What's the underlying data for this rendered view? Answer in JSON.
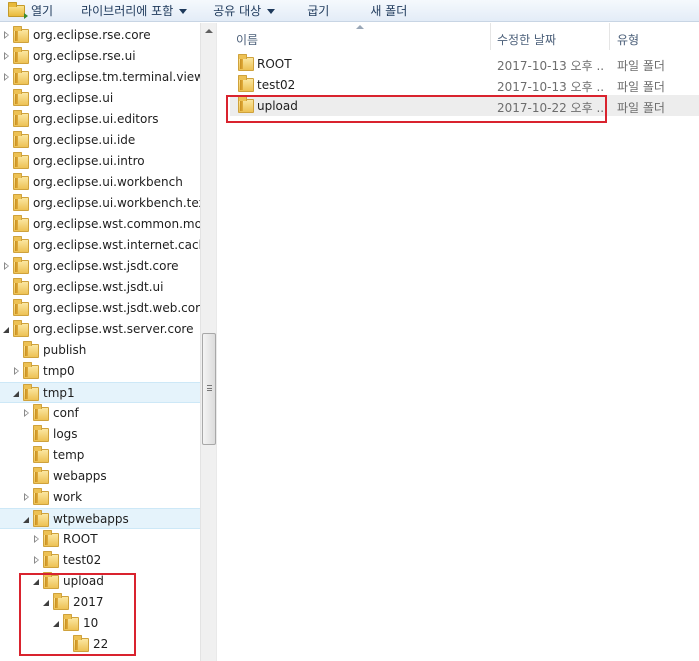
{
  "toolbar": {
    "open_label": "열기",
    "library_label": "라이브러리에 포함",
    "share_label": "공유 대상",
    "burn_label": "굽기",
    "newfolder_label": "새 폴더"
  },
  "nav_tree": [
    {
      "label": "org.eclipse.rse.core",
      "expander": "collapsed",
      "depth": 0
    },
    {
      "label": "org.eclipse.rse.ui",
      "expander": "collapsed",
      "depth": 0
    },
    {
      "label": "org.eclipse.tm.terminal.view.ui",
      "expander": "collapsed",
      "depth": 0
    },
    {
      "label": "org.eclipse.ui",
      "expander": "none",
      "depth": 0
    },
    {
      "label": "org.eclipse.ui.editors",
      "expander": "none",
      "depth": 0
    },
    {
      "label": "org.eclipse.ui.ide",
      "expander": "none",
      "depth": 0
    },
    {
      "label": "org.eclipse.ui.intro",
      "expander": "none",
      "depth": 0
    },
    {
      "label": "org.eclipse.ui.workbench",
      "expander": "none",
      "depth": 0
    },
    {
      "label": "org.eclipse.ui.workbench.texted",
      "expander": "none",
      "depth": 0
    },
    {
      "label": "org.eclipse.wst.common.modu",
      "expander": "none",
      "depth": 0
    },
    {
      "label": "org.eclipse.wst.internet.cache",
      "expander": "none",
      "depth": 0
    },
    {
      "label": "org.eclipse.wst.jsdt.core",
      "expander": "collapsed",
      "depth": 0
    },
    {
      "label": "org.eclipse.wst.jsdt.ui",
      "expander": "none",
      "depth": 0
    },
    {
      "label": "org.eclipse.wst.jsdt.web.core",
      "expander": "none",
      "depth": 0
    },
    {
      "label": "org.eclipse.wst.server.core",
      "expander": "expanded",
      "depth": 0
    },
    {
      "label": "publish",
      "expander": "none",
      "depth": 1
    },
    {
      "label": "tmp0",
      "expander": "collapsed",
      "depth": 1
    },
    {
      "label": "tmp1",
      "expander": "expanded",
      "depth": 1,
      "selected": true
    },
    {
      "label": "conf",
      "expander": "collapsed",
      "depth": 2
    },
    {
      "label": "logs",
      "expander": "none",
      "depth": 2
    },
    {
      "label": "temp",
      "expander": "none",
      "depth": 2
    },
    {
      "label": "webapps",
      "expander": "none",
      "depth": 2
    },
    {
      "label": "work",
      "expander": "collapsed",
      "depth": 2
    },
    {
      "label": "wtpwebapps",
      "expander": "expanded",
      "depth": 2,
      "selected": true
    },
    {
      "label": "ROOT",
      "expander": "collapsed",
      "depth": 3
    },
    {
      "label": "test02",
      "expander": "collapsed",
      "depth": 3
    },
    {
      "label": "upload",
      "expander": "expanded",
      "depth": 3
    },
    {
      "label": "2017",
      "expander": "expanded",
      "depth": 4
    },
    {
      "label": "10",
      "expander": "expanded",
      "depth": 5
    },
    {
      "label": "22",
      "expander": "none",
      "depth": 6
    }
  ],
  "content": {
    "columns": {
      "name": "이름",
      "modified": "수정한 날짜",
      "type": "유형"
    },
    "files": [
      {
        "name": "ROOT",
        "modified": "2017-10-13 오후 ...",
        "type": "파일 폴더"
      },
      {
        "name": "test02",
        "modified": "2017-10-13 오후 ...",
        "type": "파일 폴더"
      },
      {
        "name": "upload",
        "modified": "2017-10-22 오후 ...",
        "type": "파일 폴더",
        "selected": true
      }
    ]
  },
  "colors": {
    "callout": "#d9232e",
    "selection": "#e5f3fb",
    "folder": "#edc154"
  },
  "icons": {
    "toolbar_open": "open-folder-icon",
    "item": "folder-icon",
    "expand": "triangle-icon"
  }
}
